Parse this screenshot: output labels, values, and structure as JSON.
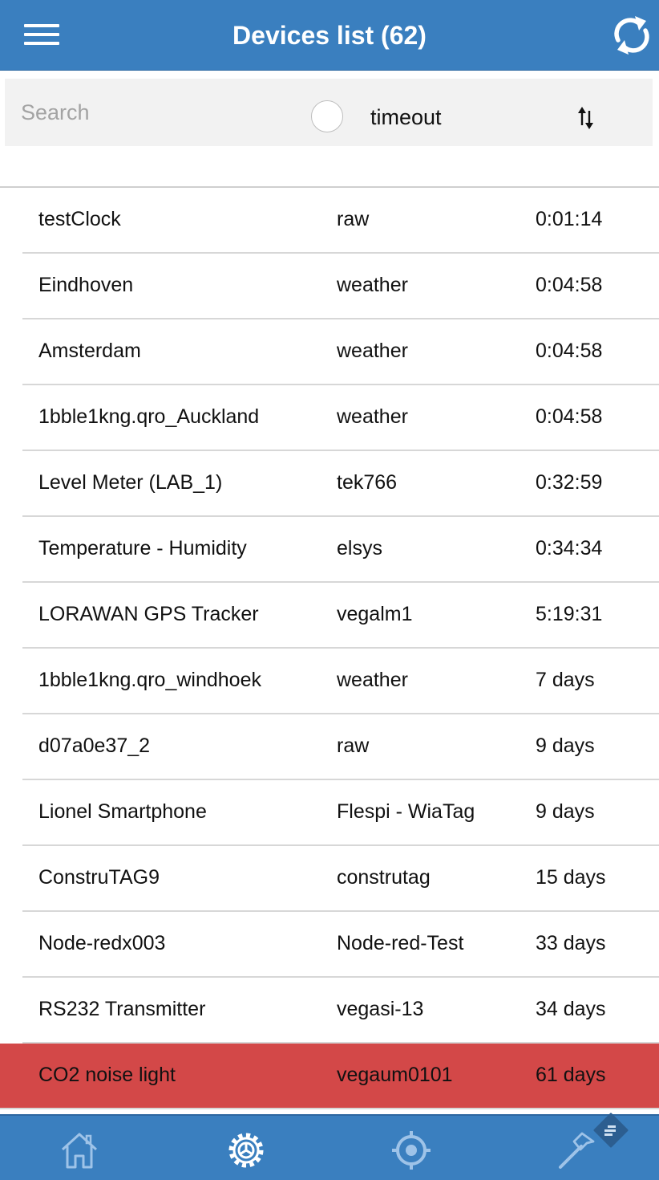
{
  "header": {
    "title": "Devices list (62)",
    "menu_icon": "hamburger-menu-icon",
    "refresh_icon": "sync-icon"
  },
  "filter": {
    "search_placeholder": "Search",
    "search_value": "",
    "radio_label": "timeout",
    "radio_checked": false,
    "sort_icon": "sort-arrows-icon"
  },
  "devices": [
    {
      "name": "testClock",
      "type": "raw",
      "timeout": "0:01:14"
    },
    {
      "name": "Eindhoven",
      "type": "weather",
      "timeout": "0:04:58"
    },
    {
      "name": "Amsterdam",
      "type": "weather",
      "timeout": "0:04:58"
    },
    {
      "name": "1bble1kng.qro_Auckland",
      "type": "weather",
      "timeout": "0:04:58"
    },
    {
      "name": "Level Meter (LAB_1)",
      "type": "tek766",
      "timeout": "0:32:59"
    },
    {
      "name": "Temperature - Humidity",
      "type": "elsys",
      "timeout": "0:34:34"
    },
    {
      "name": "LORAWAN GPS Tracker",
      "type": "vegalm1",
      "timeout": "5:19:31"
    },
    {
      "name": "1bble1kng.qro_windhoek",
      "type": "weather",
      "timeout": "7 days"
    },
    {
      "name": "d07a0e37_2",
      "type": "raw",
      "timeout": "9 days"
    },
    {
      "name": "Lionel Smartphone",
      "type": "Flespi - WiaTag",
      "timeout": "9 days"
    },
    {
      "name": "ConstruTAG9",
      "type": "construtag",
      "timeout": "15 days"
    },
    {
      "name": "Node-redx003",
      "type": "Node-red-Test",
      "timeout": "33 days"
    },
    {
      "name": "RS232 Transmitter",
      "type": "vegasi-13",
      "timeout": "34 days"
    },
    {
      "name": "CO2 noise light",
      "type": "vegaum0101",
      "timeout": "61 days",
      "status": "alert"
    }
  ],
  "colors": {
    "primary": "#3a7fbf",
    "alert_row": "#d34848",
    "search_bg": "#f2f2f2"
  },
  "tabbar": {
    "tabs": [
      {
        "icon": "home-icon",
        "active": false
      },
      {
        "icon": "settings-gear-icon",
        "active": true
      },
      {
        "icon": "location-target-icon",
        "active": false
      },
      {
        "icon": "hammer-tools-icon",
        "active": false
      }
    ],
    "overlay_icon": "feedly-badge-icon"
  }
}
